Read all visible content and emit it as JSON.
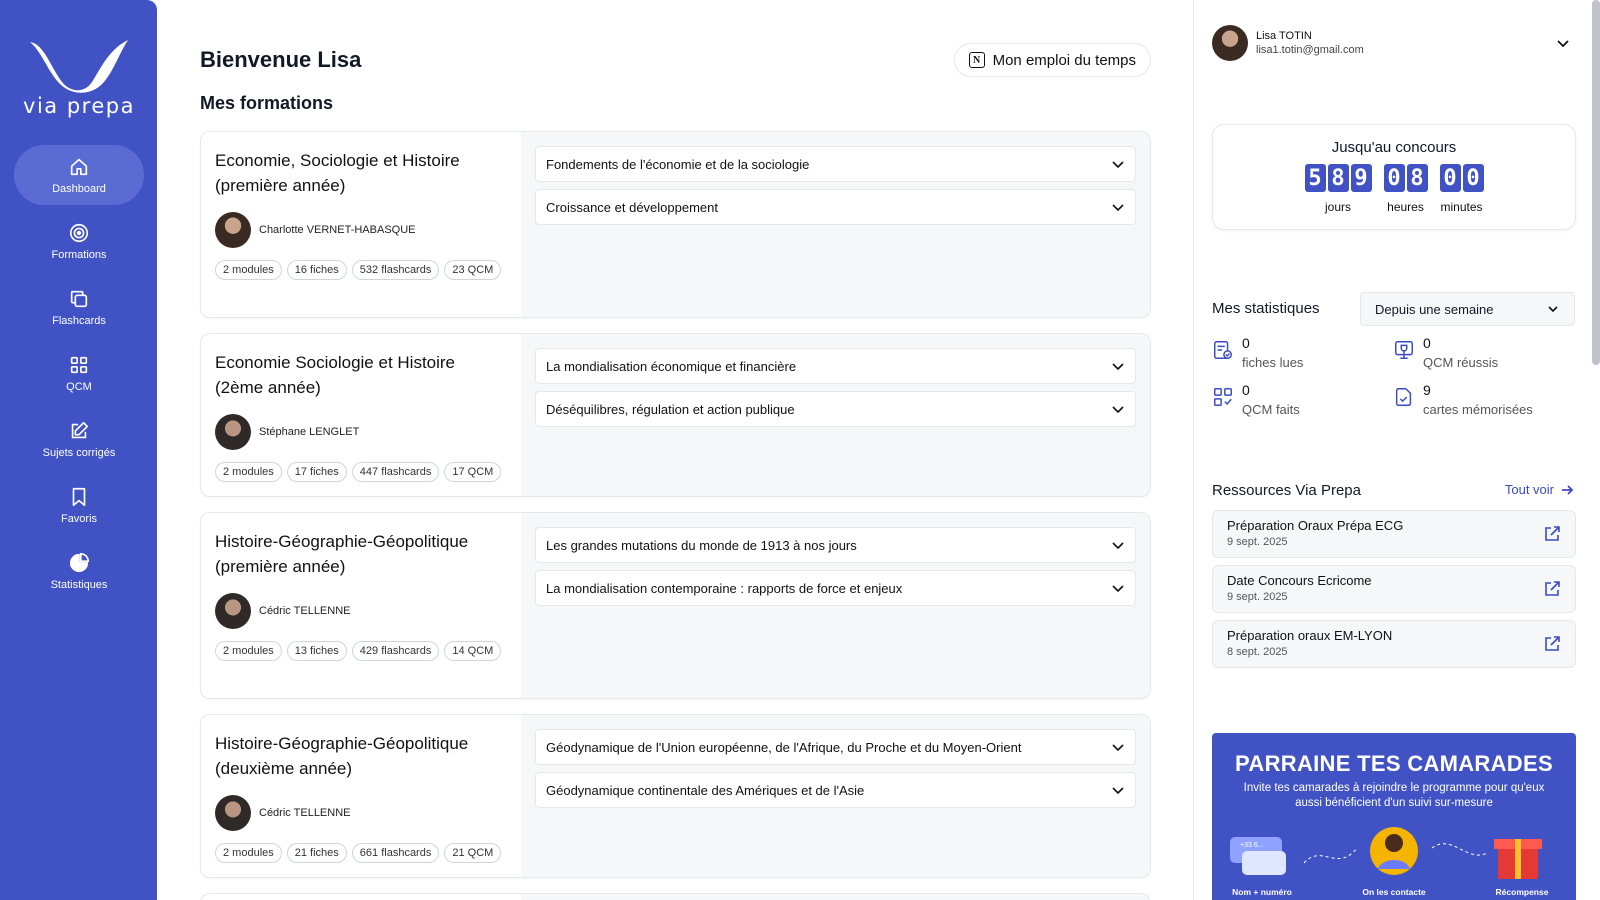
{
  "brand": {
    "name": "via prepa",
    "primary": "#4153c4"
  },
  "sidebar": {
    "items": [
      {
        "label": "Dashboard",
        "icon": "home-icon",
        "active": true
      },
      {
        "label": "Formations",
        "icon": "target-icon",
        "active": false
      },
      {
        "label": "Flashcards",
        "icon": "cards-icon",
        "active": false
      },
      {
        "label": "QCM",
        "icon": "grid-icon",
        "active": false
      },
      {
        "label": "Sujets corrigés",
        "icon": "edit-icon",
        "active": false
      },
      {
        "label": "Favoris",
        "icon": "bookmark-icon",
        "active": false
      },
      {
        "label": "Statistiques",
        "icon": "pie-chart-icon",
        "active": false
      }
    ]
  },
  "header": {
    "welcome": "Bienvenue Lisa",
    "section_title": "Mes formations",
    "timetable_label": "Mon emploi du temps"
  },
  "formations": [
    {
      "title": "Economie, Sociologie et Histoire (première année)",
      "teacher": "Charlotte VERNET-HABASQUE",
      "tags": [
        "2 modules",
        "16 fiches",
        "532 flashcards",
        "23 QCM"
      ],
      "modules": [
        "Fondements de l'économie et de la sociologie",
        "Croissance et développement"
      ]
    },
    {
      "title": "Economie Sociologie et Histoire (2ème année)",
      "teacher": "Stéphane LENGLET",
      "tags": [
        "2 modules",
        "17 fiches",
        "447 flashcards",
        "17 QCM"
      ],
      "modules": [
        "La mondialisation économique et financière",
        "Déséquilibres, régulation et action publique"
      ]
    },
    {
      "title": "Histoire-Géographie-Géopolitique (première année)",
      "teacher": "Cédric TELLENNE",
      "tags": [
        "2 modules",
        "13 fiches",
        "429 flashcards",
        "14 QCM"
      ],
      "modules": [
        "Les grandes mutations du monde de 1913 à nos jours",
        "La mondialisation contemporaine : rapports de force et enjeux"
      ]
    },
    {
      "title": "Histoire-Géographie-Géopolitique (deuxième année)",
      "teacher": "Cédric TELLENNE",
      "tags": [
        "2 modules",
        "21 fiches",
        "661 flashcards",
        "21 QCM"
      ],
      "modules": [
        "Géodynamique de l'Union européenne, de l'Afrique, du Proche et du Moyen-Orient",
        "Géodynamique continentale des Amériques et de l'Asie"
      ]
    }
  ],
  "user": {
    "name": "Lisa TOTIN",
    "email": "lisa1.totin@gmail.com"
  },
  "countdown": {
    "title": "Jusqu'au concours",
    "days": "589",
    "hours": "08",
    "minutes": "00",
    "days_label": "jours",
    "hours_label": "heures",
    "minutes_label": "minutes"
  },
  "stats": {
    "title": "Mes statistiques",
    "period": "Depuis une semaine",
    "items": [
      {
        "value": "0",
        "label": "fiches lues",
        "icon": "document-check-icon"
      },
      {
        "value": "0",
        "label": "QCM réussis",
        "icon": "trophy-icon"
      },
      {
        "value": "0",
        "label": "QCM faits",
        "icon": "grid-check-icon"
      },
      {
        "value": "9",
        "label": "cartes mémorisées",
        "icon": "card-check-icon"
      }
    ]
  },
  "resources": {
    "title": "Ressources Via Prepa",
    "see_all": "Tout voir",
    "items": [
      {
        "name": "Préparation Oraux Prépa ECG",
        "date": "9 sept. 2025"
      },
      {
        "name": "Date Concours Ecricome",
        "date": "9 sept. 2025"
      },
      {
        "name": "Préparation oraux EM-LYON",
        "date": "8 sept. 2025"
      }
    ]
  },
  "promo": {
    "title": "PARRAINE TES CAMARADES",
    "subtitle": "Invite tes camarades à rejoindre le programme pour qu'eux aussi bénéficient d'un suivi sur-mesure",
    "steps": [
      "Nom + numéro",
      "On les contacte",
      "Récompense"
    ],
    "badge": "+33 6..."
  }
}
